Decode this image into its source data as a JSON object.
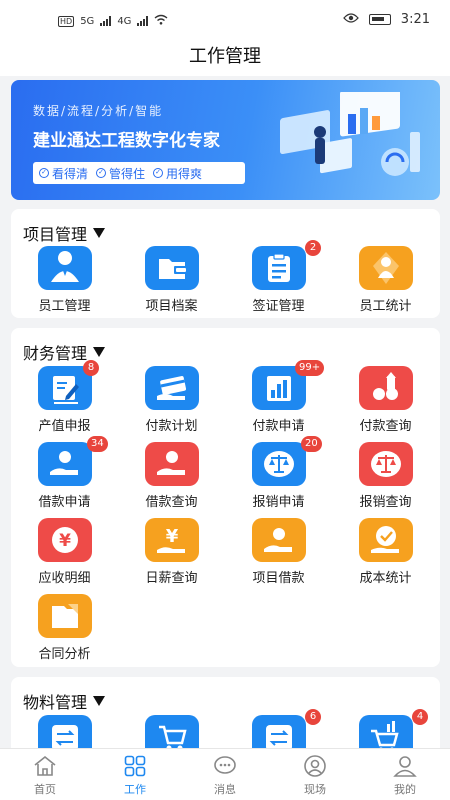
{
  "status": {
    "time": "3:21",
    "net1": "5G",
    "net2": "4G"
  },
  "header": {
    "title": "工作管理"
  },
  "banner": {
    "subtitle": "数据/流程/分析/智能",
    "title": "建业通达工程数字化专家",
    "chips": [
      "看得清",
      "管得住",
      "用得爽"
    ]
  },
  "sections": [
    {
      "title": "项目管理",
      "items": [
        {
          "label": "员工管理",
          "color": "#1e88f0",
          "icon": "person-icon"
        },
        {
          "label": "项目档案",
          "color": "#1e88f0",
          "icon": "folder-icon"
        },
        {
          "label": "签证管理",
          "color": "#1e88f0",
          "icon": "clipboard-icon",
          "badge": "2"
        },
        {
          "label": "员工统计",
          "color": "#f6a11f",
          "icon": "person-stats-icon"
        }
      ]
    },
    {
      "title": "财务管理",
      "items": [
        {
          "label": "产值申报",
          "color": "#1e88f0",
          "icon": "edit-icon",
          "badge": "8"
        },
        {
          "label": "付款计划",
          "color": "#1e88f0",
          "icon": "card-pay-icon"
        },
        {
          "label": "付款申请",
          "color": "#1e88f0",
          "icon": "bar-chart-icon",
          "badge": "99+"
        },
        {
          "label": "付款查询",
          "color": "#ee4b48",
          "icon": "coins-icon"
        },
        {
          "label": "借款申请",
          "color": "#1e88f0",
          "icon": "loan-icon",
          "badge": "34"
        },
        {
          "label": "借款查询",
          "color": "#ee4b48",
          "icon": "loan-query-icon"
        },
        {
          "label": "报销申请",
          "color": "#1e88f0",
          "icon": "scale-icon",
          "badge": "20"
        },
        {
          "label": "报销查询",
          "color": "#ee4b48",
          "icon": "scale-query-icon"
        },
        {
          "label": "应收明细",
          "color": "#ee4b48",
          "icon": "yen-icon"
        },
        {
          "label": "日薪查询",
          "color": "#f6a11f",
          "icon": "yen-hand-icon"
        },
        {
          "label": "项目借款",
          "color": "#f6a11f",
          "icon": "hand-coin-icon"
        },
        {
          "label": "成本统计",
          "color": "#f6a11f",
          "icon": "check-hand-icon"
        },
        {
          "label": "合同分析",
          "color": "#f6a11f",
          "icon": "contract-folder-icon"
        }
      ]
    },
    {
      "title": "物料管理",
      "items": [
        {
          "label": "",
          "color": "#1e88f0",
          "icon": "transfer-icon"
        },
        {
          "label": "",
          "color": "#1e88f0",
          "icon": "cart-icon"
        },
        {
          "label": "",
          "color": "#1e88f0",
          "icon": "transfer-icon",
          "badge": "6"
        },
        {
          "label": "",
          "color": "#1e88f0",
          "icon": "cart-chart-icon",
          "badge": "4"
        }
      ]
    }
  ],
  "tabbar": {
    "items": [
      {
        "label": "首页",
        "icon": "home-icon",
        "active": false
      },
      {
        "label": "工作",
        "icon": "grid-icon",
        "active": true
      },
      {
        "label": "消息",
        "icon": "message-icon",
        "active": false
      },
      {
        "label": "现场",
        "icon": "site-icon",
        "active": false
      },
      {
        "label": "我的",
        "icon": "user-icon",
        "active": false
      }
    ]
  }
}
